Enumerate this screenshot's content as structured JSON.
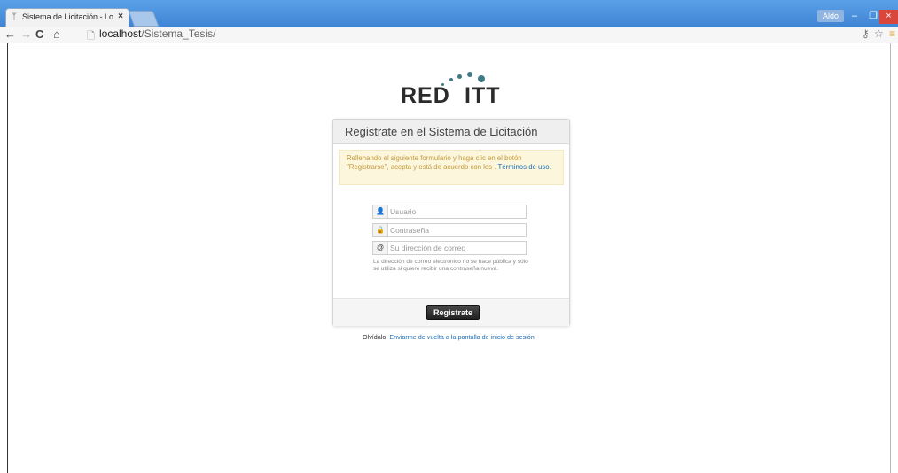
{
  "browser": {
    "tab_title": "Sistema de Licitación - Lo",
    "user_badge": "Aldo",
    "url_host": "localhost",
    "url_path": "/Sistema_Tesis/"
  },
  "logo": {
    "left": "RED",
    "right": "ITT",
    "dot_color": "#3d7a86"
  },
  "panel": {
    "title": "Registrate en el Sistema de Licitación",
    "alert_text": "Rellenando el siguiente formulario y haga clic en el botón \"Registrarse\", acepta y está de acuerdo con los . ",
    "alert_link": "Términos de uso",
    "alert_end": ".",
    "username_placeholder": "Usuario",
    "password_placeholder": "Contraseña",
    "email_placeholder": "Su dirección de correo",
    "email_addon": "@",
    "help_text": "La dirección de correo electrónico no se hace pública y sólo se utiliza si quiere recibir una contraseña nueva.",
    "submit_label": "Registrate"
  },
  "footer": {
    "prefix": "Olvídalo, ",
    "link": "Enviarme de vuelta a la pantalla de inicio de sesión"
  },
  "colors": {
    "titlebar": "#4a90d9",
    "alert_bg": "#fcf6dc",
    "alert_text": "#c49a3c",
    "link": "#1f6fb5",
    "button": "#333333"
  }
}
